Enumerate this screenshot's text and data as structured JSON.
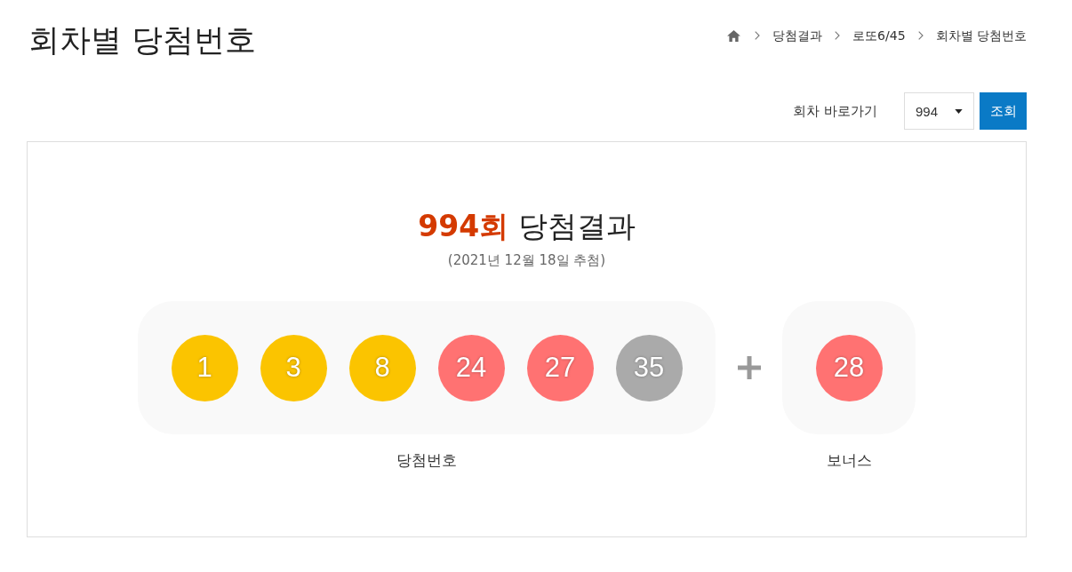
{
  "page_title": "회차별 당첨번호",
  "breadcrumb": [
    "당첨결과",
    "로또6/45",
    "회차별 당첨번호"
  ],
  "round_picker": {
    "label": "회차 바로가기",
    "value": "994",
    "button": "조회"
  },
  "result": {
    "title": "**994회** 당첨결과",
    "draw_date": "(2021년 12월 18일 추첨)",
    "winning": {
      "label": "당첨번호",
      "balls": [
        {
          "number": "1",
          "color": "#fbc400"
        },
        {
          "number": "3",
          "color": "#fbc400"
        },
        {
          "number": "8",
          "color": "#fbc400"
        },
        {
          "number": "24",
          "color": "#ff7272"
        },
        {
          "number": "27",
          "color": "#ff7272"
        },
        {
          "number": "35",
          "color": "#aaaaaa"
        }
      ]
    },
    "bonus": {
      "label": "보너스",
      "balls": [
        {
          "number": "28",
          "color": "#ff7272"
        }
      ]
    }
  }
}
